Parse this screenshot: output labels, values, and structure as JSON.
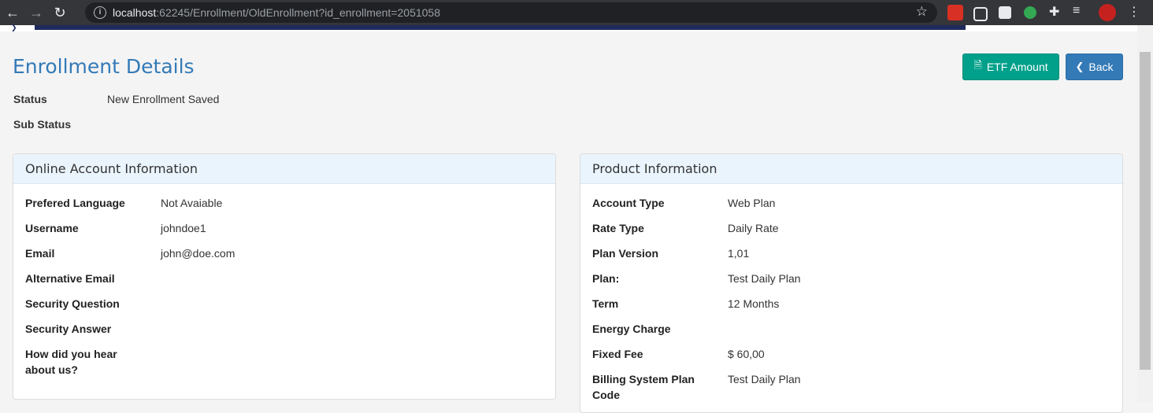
{
  "browser": {
    "url_host": "localhost",
    "url_rest": ":62245/Enrollment/OldEnrollment?id_enrollment=2051058"
  },
  "page": {
    "title": "Enrollment Details",
    "buttons": {
      "etf": "ETF Amount",
      "back": "Back"
    }
  },
  "summary": [
    {
      "label": "Status",
      "value": "New Enrollment Saved"
    },
    {
      "label": "Sub Status",
      "value": ""
    }
  ],
  "online_account": {
    "heading": "Online Account Information",
    "rows": [
      {
        "label": "Prefered Language",
        "value": "Not Avaiable"
      },
      {
        "label": "Username",
        "value": "johndoe1"
      },
      {
        "label": "Email",
        "value": "john@doe.com"
      },
      {
        "label": "Alternative Email",
        "value": ""
      },
      {
        "label": "Security Question",
        "value": ""
      },
      {
        "label": "Security Answer",
        "value": ""
      },
      {
        "label": "How did you hear",
        "label2": "about us?",
        "value": ""
      }
    ]
  },
  "product": {
    "heading": "Product Information",
    "rows": [
      {
        "label": "Account Type",
        "value": "Web Plan"
      },
      {
        "label": "Rate Type",
        "value": "Daily Rate"
      },
      {
        "label": "Plan Version",
        "value": "1,01"
      },
      {
        "label": "Plan:",
        "value": "Test Daily Plan"
      },
      {
        "label": "Term",
        "value": "12 Months"
      },
      {
        "label": "Energy Charge",
        "value": ""
      },
      {
        "label": "Fixed Fee",
        "value": "$ 60,00"
      },
      {
        "label": "Billing System Plan",
        "label2": "Code",
        "value": "Test Daily Plan"
      }
    ]
  },
  "colors": {
    "primary": "#337ab7",
    "teal": "#00a08a",
    "panel_head": "#eaf4fd"
  }
}
